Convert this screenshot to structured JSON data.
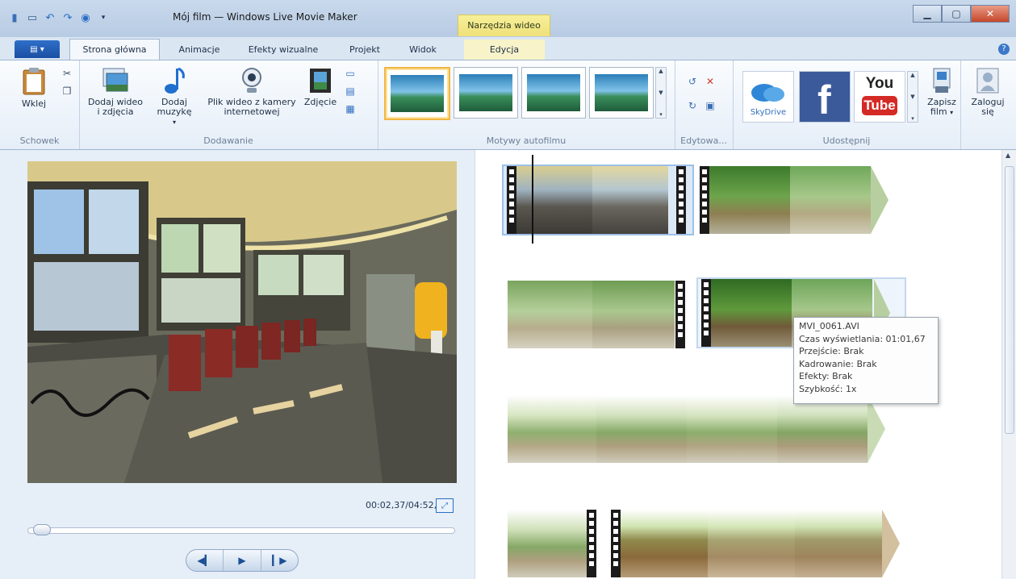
{
  "window": {
    "title": "Mój film — Windows Live Movie Maker",
    "context_tab": "Narzędzia wideo"
  },
  "tabs": [
    {
      "label": "Strona główna",
      "active": true
    },
    {
      "label": "Animacje"
    },
    {
      "label": "Efekty wizualne"
    },
    {
      "label": "Projekt"
    },
    {
      "label": "Widok"
    },
    {
      "label": "Edycja"
    }
  ],
  "ribbon": {
    "schowek": {
      "label": "Schowek",
      "paste": "Wklej"
    },
    "dodawanie": {
      "label": "Dodawanie",
      "add_video_1": "Dodaj wideo",
      "add_video_2": "i zdjęcia",
      "add_music_1": "Dodaj",
      "add_music_2": "muzykę",
      "webcam_1": "Plik wideo z kamery",
      "webcam_2": "internetowej",
      "snapshot": "Zdjęcie"
    },
    "motywy": {
      "label": "Motywy autofilmu"
    },
    "edytowanie": {
      "label": "Edytowa..."
    },
    "udostepnij": {
      "label": "Udostępnij",
      "skydrive": "SkyDrive",
      "youtube_1": "You",
      "youtube_2": "Tube",
      "save_1": "Zapisz",
      "save_2": "film",
      "signin_1": "Zaloguj",
      "signin_2": "się"
    }
  },
  "preview": {
    "time": "00:02,37/04:52,75",
    "seek_fraction": 0.01
  },
  "tooltip": {
    "file": "MVI_0061.AVI",
    "duration": "Czas wyświetlania: 01:01,67",
    "transition": "Przejście: Brak",
    "crop": "Kadrowanie: Brak",
    "effects": "Efekty: Brak",
    "speed": "Szybkość: 1x"
  },
  "colors": {
    "brand_blue": "#1b4fa3",
    "selection_gold": "#f2b642",
    "context_yellow": "#efe07a",
    "close_red": "#c4472a"
  }
}
